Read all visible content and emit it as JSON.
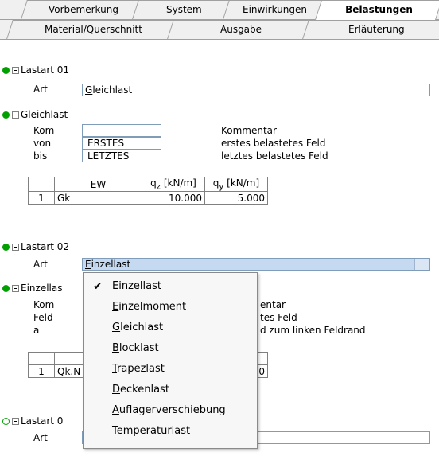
{
  "tabs_row1": [
    {
      "label": "Vorbemerkung"
    },
    {
      "label": "System"
    },
    {
      "label": "Einwirkungen"
    },
    {
      "label": "Belastungen",
      "active": true
    }
  ],
  "tabs_row2": [
    {
      "label": "Material/Querschnitt"
    },
    {
      "label": "Ausgabe"
    },
    {
      "label": "Erläuterung"
    }
  ],
  "lastart01": {
    "header": "Lastart 01",
    "art_label": "Art",
    "art_first": "G",
    "art_rest": "leichlast"
  },
  "gleichlast": {
    "header": "Gleichlast",
    "rows": [
      {
        "label": "Kom",
        "value": "",
        "desc": "Kommentar"
      },
      {
        "label": "von",
        "value": "ERSTES",
        "desc": "erstes belastetes Feld"
      },
      {
        "label": "bis",
        "value": "LETZTES",
        "desc": "letztes belastetes Feld"
      }
    ],
    "table_head": [
      "",
      "EW",
      "q_z [kN/m]",
      "q_y [kN/m]"
    ],
    "table_row": [
      "1",
      "Gk",
      "10.000",
      "5.000"
    ]
  },
  "lastart02": {
    "header": "Lastart 02",
    "art_label": "Art",
    "art_first": "E",
    "art_rest": "inzellast"
  },
  "einzellast": {
    "header_visible": "Einzellas",
    "labels": [
      "Kom",
      "Feld",
      "a"
    ],
    "desc_partial": [
      "entar",
      "tes Feld",
      "d zum linken Feldrand"
    ],
    "table_row_partial": [
      "1",
      "Qk.N",
      "000"
    ],
    "table_head_partial": "]"
  },
  "lastart03": {
    "header_visible": "Lastart 0",
    "art_label": "Art"
  },
  "dropdown": {
    "items": [
      {
        "first": "E",
        "rest": "inzellast",
        "selected": true
      },
      {
        "first": "E",
        "rest": "inzelmoment"
      },
      {
        "first": "G",
        "rest": "leichlast"
      },
      {
        "first": "B",
        "rest": "locklast"
      },
      {
        "first": "T",
        "rest": "rapezlast"
      },
      {
        "first": "D",
        "rest": "eckenlast"
      },
      {
        "first": "A",
        "rest": "uflagerverschiebung"
      },
      {
        "pre": "Tem",
        "first": "p",
        "rest": "eraturlast"
      }
    ]
  },
  "colors": {
    "green": "#00a000",
    "selection": "#c5d9f1",
    "border": "#7f9db9"
  }
}
